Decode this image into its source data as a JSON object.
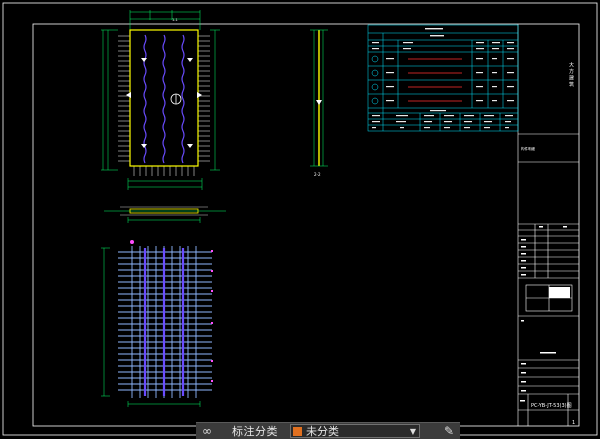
{
  "toolbar": {
    "link_icon": "link-icon",
    "label": "标注分类",
    "selected_category": "未分类",
    "category_color": "#e07020",
    "dropdown_icon": "caret-down-icon",
    "edit_icon": "pen-icon"
  },
  "title_block": {
    "project_title": "大 方 建 筑",
    "table_header": "构件明细",
    "drawing_number": "PC-YB-JT-53(3)图",
    "page_number": "1"
  },
  "drawing": {
    "section_label_top": "1-1",
    "section_label_mid": "2-2"
  },
  "colors": {
    "background": "#000000",
    "frame": "#ffffff",
    "rebar_green": "#00ff66",
    "outline_yellow": "#ffff00",
    "cyan_table": "#00e5ff",
    "steel_blue": "#8fb8ff",
    "magenta": "#ff4dff",
    "purple_bars": "#6a4cff"
  }
}
